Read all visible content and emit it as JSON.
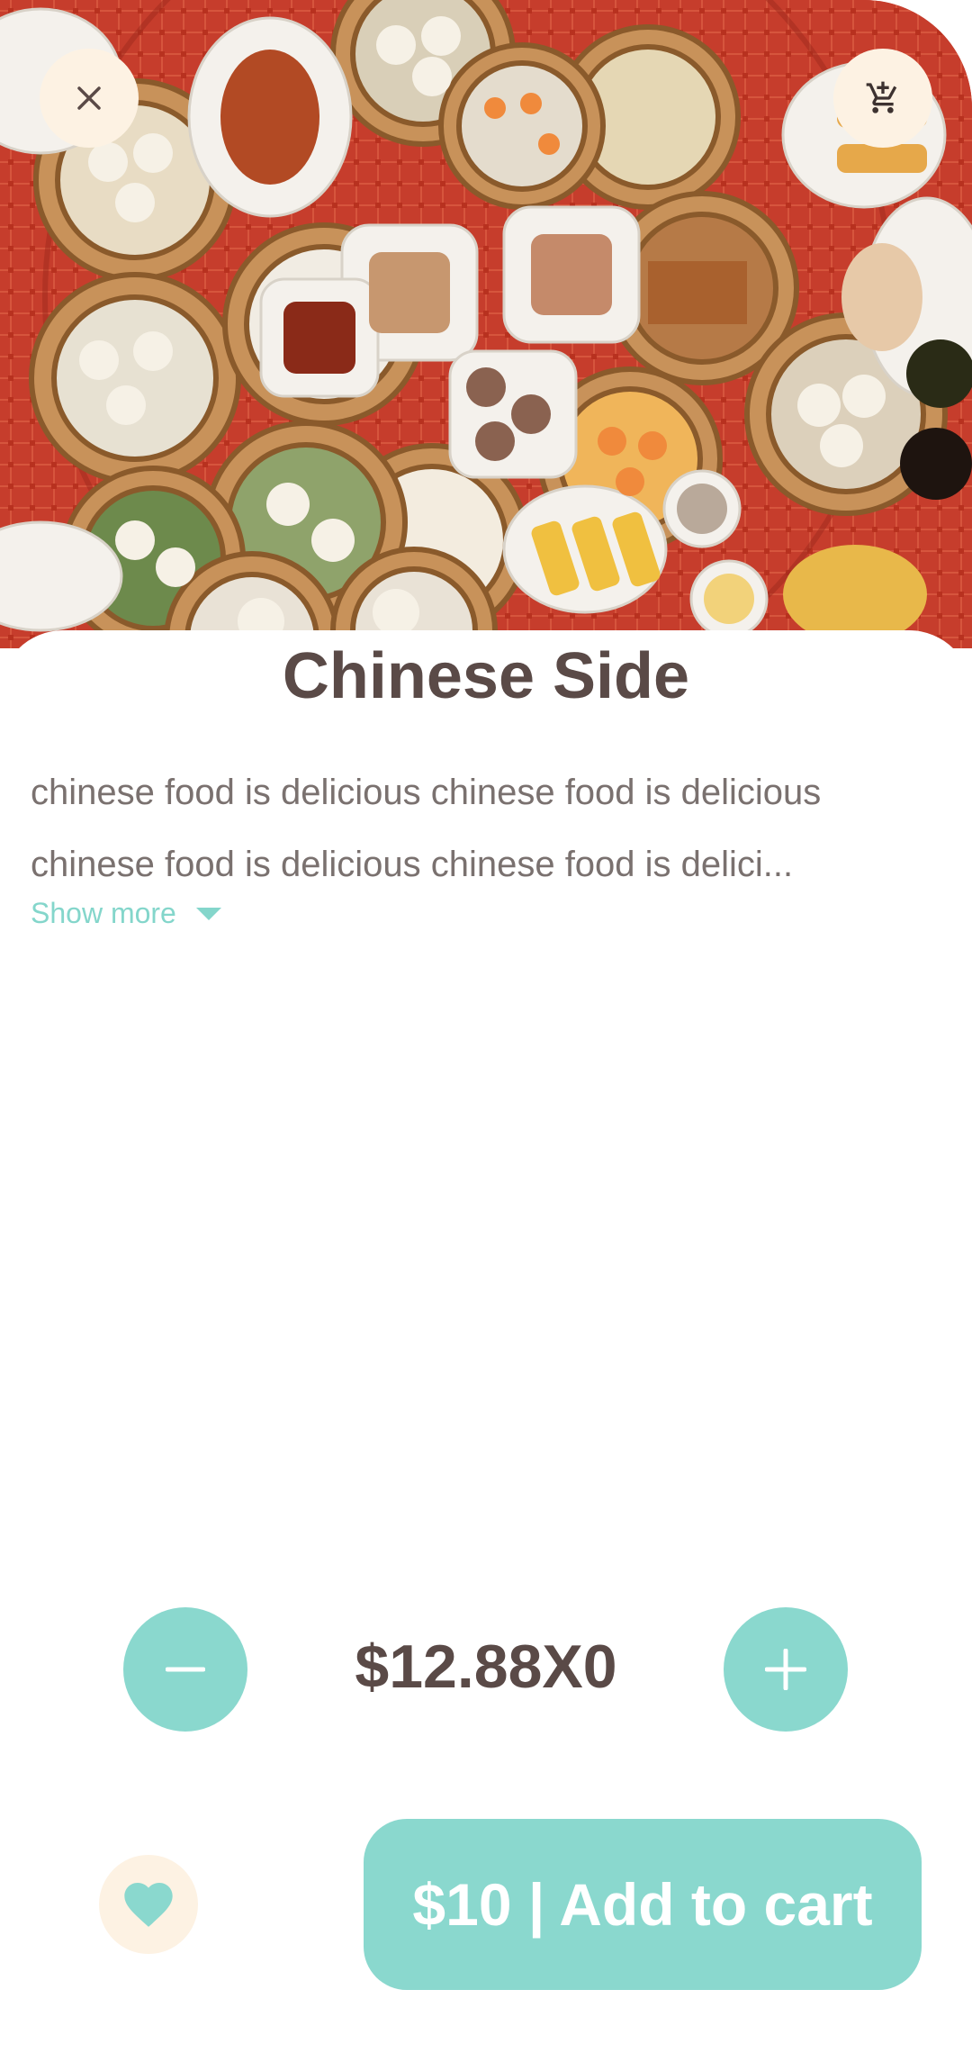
{
  "product": {
    "name": "Chinese Side",
    "description": "chinese food is delicious chinese food is delicious chinese food is delicious chinese food is delici...",
    "show_more_label": "Show more"
  },
  "quantity": {
    "price_display": "$12.88X0"
  },
  "footer": {
    "add_to_cart_label": "$10 | Add to cart"
  },
  "icons": {
    "close": "close-icon",
    "cart": "add-shopping-cart-icon",
    "minus": "minus-icon",
    "plus": "plus-icon",
    "favorite": "heart-icon",
    "show_more": "caret-down-icon"
  },
  "colors": {
    "accent": "#8ad8ce",
    "button_bg_light": "#fdf2e3",
    "title_text": "#5a4a47",
    "body_text": "#7a716f",
    "link_text": "#84d6cb",
    "hero_table": "#c33a2a"
  }
}
